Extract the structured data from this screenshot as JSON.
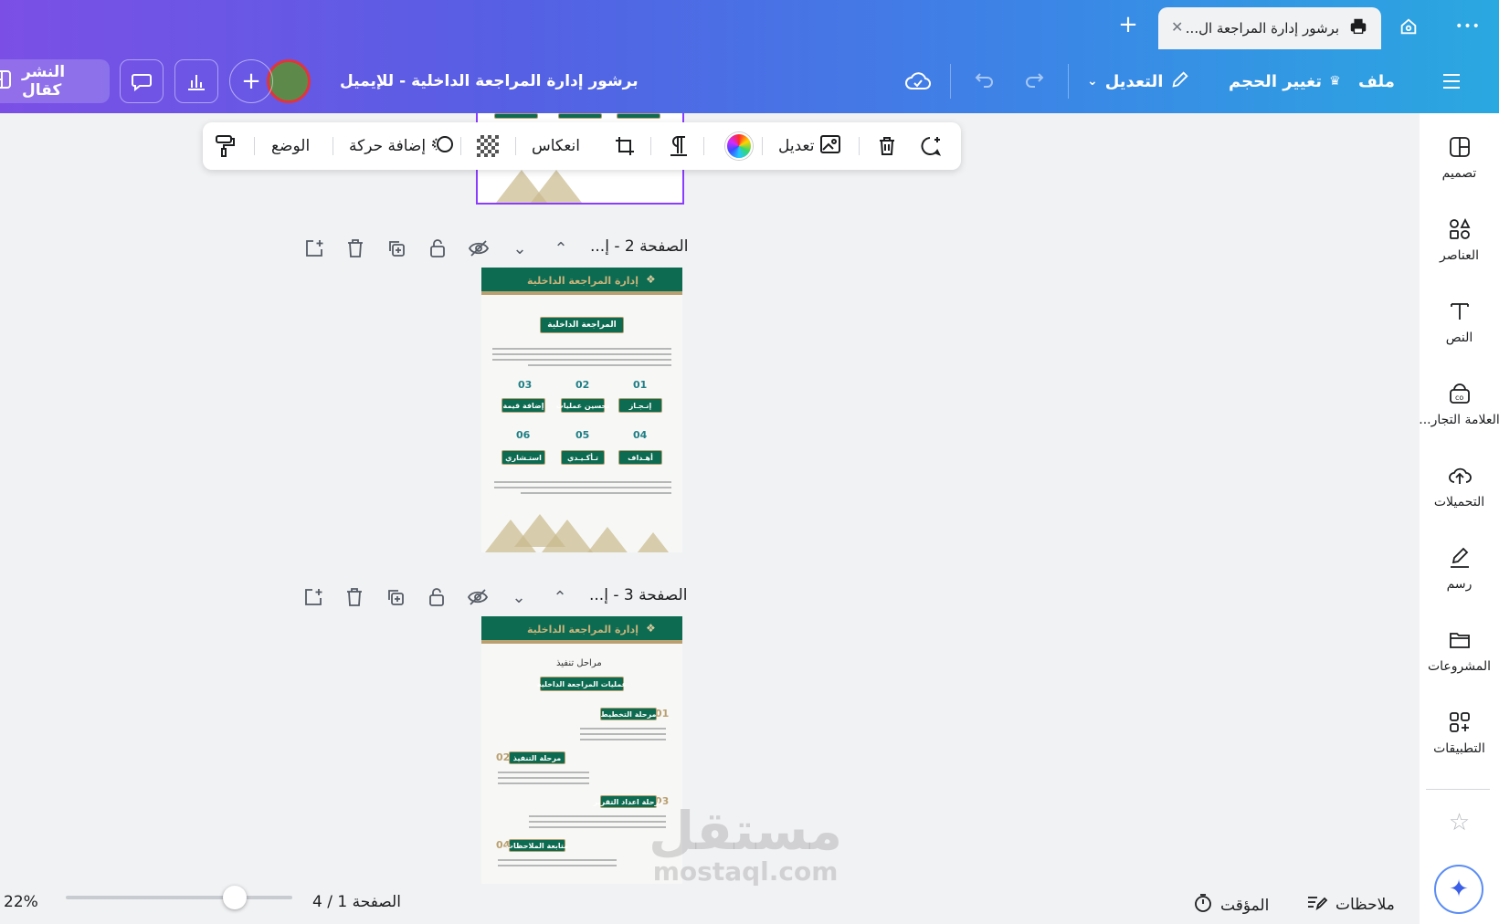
{
  "tabbar": {
    "tab_title": "برشور إدارة المراجعة ال...",
    "more_label": "•••"
  },
  "header": {
    "menu_label": "ملف",
    "resize_label": "تغيير الحجم",
    "edit_label": "التعديل",
    "doc_title": "برشور إدارة المراجعة الداخلية - للإيميل",
    "publish_label": "النشر كقال"
  },
  "context_toolbar": {
    "edit_image_label": "تعديل",
    "flip_label": "انعكاس",
    "animate_label": "إضافة حركة",
    "position_label": "الوضع"
  },
  "pages": [
    {
      "label": "الصفحة 2 - إ...",
      "header_title": "إدارة المراجعة الداخلية",
      "section_title": "المراجعة الداخلية",
      "items": [
        {
          "num": "01",
          "label": "إنـجـاز"
        },
        {
          "num": "02",
          "label": "تحسين عمليات"
        },
        {
          "num": "03",
          "label": "إضافة قيمة"
        },
        {
          "num": "04",
          "label": "أهـداف"
        },
        {
          "num": "05",
          "label": "تـأكـيـدي"
        },
        {
          "num": "06",
          "label": "استـشاري"
        }
      ]
    },
    {
      "label": "الصفحة 3 - إ...",
      "header_title": "إدارة المراجعة الداخلية",
      "subtitle": "مراحل تنفيذ",
      "section_title": "عمليات المراجعة الداخلية",
      "phases": [
        {
          "num": "01",
          "label": "مرحلة التخطيط"
        },
        {
          "num": "02",
          "label": "مرحلة التنفيذ"
        },
        {
          "num": "03",
          "label": "مرحلة اعداد التقرير"
        },
        {
          "num": "04",
          "label": "متابعة الملاحظات"
        }
      ]
    }
  ],
  "sidebar": {
    "items": [
      {
        "label": "تصميم",
        "icon": "layout-icon"
      },
      {
        "label": "العناصر",
        "icon": "elements-icon"
      },
      {
        "label": "النص",
        "icon": "text-icon"
      },
      {
        "label": "العلامة التجار...",
        "icon": "brand-icon"
      },
      {
        "label": "التحميلات",
        "icon": "upload-icon"
      },
      {
        "label": "رسم",
        "icon": "draw-icon"
      },
      {
        "label": "المشروعات",
        "icon": "folder-icon"
      },
      {
        "label": "التطبيقات",
        "icon": "apps-icon"
      }
    ]
  },
  "bottom": {
    "notes_label": "ملاحظات",
    "timer_label": "المؤقت",
    "page_indicator": "الصفحة 1 / 4",
    "zoom": "22%"
  },
  "watermark": {
    "arabic": "مستقل",
    "latin": "mostaql.com"
  },
  "colors": {
    "accent_green": "#0d6b51",
    "gold": "#b9a071",
    "selection_purple": "#8b3dff"
  }
}
